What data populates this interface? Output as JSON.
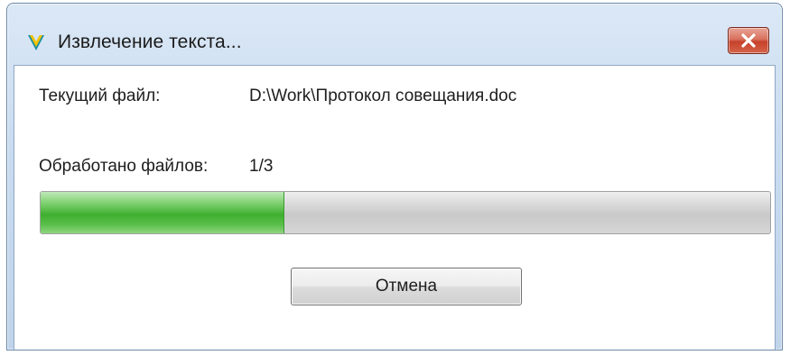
{
  "window": {
    "title": "Извлечение текста...",
    "app_icon": "app-logo-icon",
    "close_icon": "close-icon"
  },
  "current_file": {
    "label": "Текущий файл:",
    "value": "D:\\Work\\Протокол совещания.doc"
  },
  "processed": {
    "label": "Обработано файлов:",
    "value": "1/3"
  },
  "progress": {
    "fraction": 0.333
  },
  "buttons": {
    "cancel_label": "Отмена"
  },
  "colors": {
    "progress_fill": "#3fae2f",
    "close_button": "#c7412a",
    "app_icon_yellow": "#f2c300",
    "app_icon_teal": "#1b8fa0"
  }
}
